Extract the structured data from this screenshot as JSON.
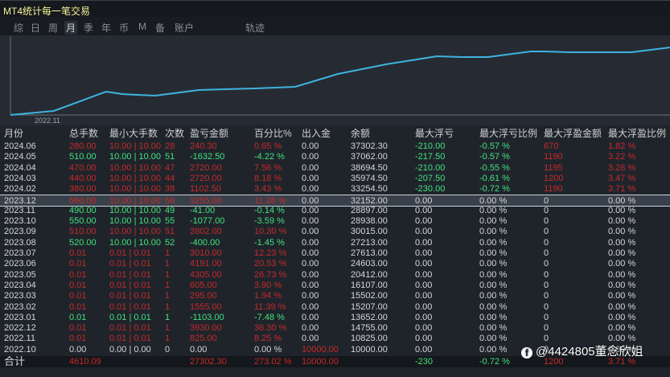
{
  "title": "MT4统计每一笔交易",
  "tabs": [
    {
      "label": "综",
      "active": false
    },
    {
      "label": "日",
      "active": false
    },
    {
      "label": "周",
      "active": false
    },
    {
      "label": "月",
      "active": true
    },
    {
      "label": "季",
      "active": false
    },
    {
      "label": "年",
      "active": false
    },
    {
      "label": "币",
      "active": false
    },
    {
      "label": "M",
      "active": false
    },
    {
      "label": "备",
      "active": false
    },
    {
      "label": "账户",
      "active": false
    },
    {
      "label": "轨迹",
      "active": false
    }
  ],
  "chart": {
    "x_label": "2022.11",
    "line_color": "#3fb3e0"
  },
  "columns": [
    "月份",
    "总手数",
    "最小大手数",
    "次数",
    "盈亏金额",
    "百分比%",
    "出入金",
    "余额",
    "最大浮亏",
    "最大浮亏比例",
    "最大浮盈金额",
    "最大浮盈比例"
  ],
  "rows": [
    {
      "c": [
        "2024.06",
        "280.00",
        "10.00 | 10.00",
        "28",
        "240.30",
        "0.65 %",
        "0.00",
        "37302.30",
        "-210.00",
        "-0.57 %",
        "670",
        "1.82 %"
      ],
      "tone": "r"
    },
    {
      "c": [
        "2024.05",
        "510.00",
        "10.00 | 10.00",
        "51",
        "-1632.50",
        "-4.22 %",
        "0.00",
        "37062.00",
        "-217.50",
        "-0.57 %",
        "1190",
        "3.22 %"
      ],
      "tone": "g"
    },
    {
      "c": [
        "2024.04",
        "470.00",
        "10.00 | 10.00",
        "47",
        "2720.00",
        "7.56 %",
        "0.00",
        "38694.50",
        "-210.00",
        "-0.55 %",
        "1195",
        "3.28 %"
      ],
      "tone": "r"
    },
    {
      "c": [
        "2024.03",
        "440.00",
        "10.00 | 10.00",
        "44",
        "2720.00",
        "8.18 %",
        "0.00",
        "35974.50",
        "-207.50",
        "-0.61 %",
        "1200",
        "3.47 %"
      ],
      "tone": "r"
    },
    {
      "c": [
        "2024.02",
        "380.00",
        "10.00 | 10.00",
        "38",
        "1102.50",
        "3.43 %",
        "0.00",
        "33254.50",
        "-230.00",
        "-0.72 %",
        "1190",
        "3.71 %"
      ],
      "tone": "r"
    },
    {
      "c": [
        "2023.12",
        "560.00",
        "10.00 | 10.00",
        "56",
        "3255.00",
        "11.26 %",
        "0.00",
        "32152.00",
        "0.00",
        "0.00 %",
        "0",
        "0.00 %"
      ],
      "tone": "r",
      "selected": true
    },
    {
      "c": [
        "2023.11",
        "490.00",
        "10.00 | 10.00",
        "49",
        "-41.00",
        "-0.14 %",
        "0.00",
        "28897.00",
        "0.00",
        "0.00 %",
        "0",
        "0.00 %"
      ],
      "tone": "g"
    },
    {
      "c": [
        "2023.10",
        "550.00",
        "10.00 | 10.00",
        "55",
        "-1077.00",
        "-3.59 %",
        "0.00",
        "28938.00",
        "0.00",
        "0.00 %",
        "0",
        "0.00 %"
      ],
      "tone": "g"
    },
    {
      "c": [
        "2023.09",
        "510.00",
        "10.00 | 10.00",
        "51",
        "2802.00",
        "10.30 %",
        "0.00",
        "30015.00",
        "0.00",
        "0.00 %",
        "0",
        "0.00 %"
      ],
      "tone": "r"
    },
    {
      "c": [
        "2023.08",
        "520.00",
        "10.00 | 10.00",
        "52",
        "-400.00",
        "-1.45 %",
        "0.00",
        "27213.00",
        "0.00",
        "0.00 %",
        "0",
        "0.00 %"
      ],
      "tone": "g"
    },
    {
      "c": [
        "2023.07",
        "0.01",
        "0.01 | 0.01",
        "1",
        "3010.00",
        "12.23 %",
        "0.00",
        "27613.00",
        "0.00",
        "0.00 %",
        "0",
        "0.00 %"
      ],
      "tone": "r"
    },
    {
      "c": [
        "2023.06",
        "0.01",
        "0.01 | 0.01",
        "1",
        "4191.00",
        "20.53 %",
        "0.00",
        "24603.00",
        "0.00",
        "0.00 %",
        "0",
        "0.00 %"
      ],
      "tone": "r"
    },
    {
      "c": [
        "2023.05",
        "0.01",
        "0.01 | 0.01",
        "1",
        "4305.00",
        "26.73 %",
        "0.00",
        "20412.00",
        "0.00",
        "0.00 %",
        "0",
        "0.00 %"
      ],
      "tone": "r"
    },
    {
      "c": [
        "2023.04",
        "0.01",
        "0.01 | 0.01",
        "1",
        "605.00",
        "3.90 %",
        "0.00",
        "16107.00",
        "0.00",
        "0.00 %",
        "0",
        "0.00 %"
      ],
      "tone": "r"
    },
    {
      "c": [
        "2023.03",
        "0.01",
        "0.01 | 0.01",
        "1",
        "295.00",
        "1.94 %",
        "0.00",
        "15502.00",
        "0.00",
        "0.00 %",
        "0",
        "0.00 %"
      ],
      "tone": "r"
    },
    {
      "c": [
        "2023.02",
        "0.01",
        "0.01 | 0.01",
        "1",
        "1555.00",
        "11.39 %",
        "0.00",
        "15207.00",
        "0.00",
        "0.00 %",
        "0",
        "0.00 %"
      ],
      "tone": "r"
    },
    {
      "c": [
        "2023.01",
        "0.01",
        "0.01 | 0.01",
        "1",
        "-1103.00",
        "-7.48 %",
        "0.00",
        "13652.00",
        "0.00",
        "0.00 %",
        "0",
        "0.00 %"
      ],
      "tone": "g"
    },
    {
      "c": [
        "2022.12",
        "0.01",
        "0.01 | 0.01",
        "1",
        "3930.00",
        "36.30 %",
        "0.00",
        "14755.00",
        "0.00",
        "0.00 %",
        "0",
        "0.00 %"
      ],
      "tone": "r"
    },
    {
      "c": [
        "2022.11",
        "0.01",
        "0.01 | 0.01",
        "1",
        "825.00",
        "8.25 %",
        "0.00",
        "10825.00",
        "0.00",
        "0.00 %",
        "0",
        "0.00 %"
      ],
      "tone": "r"
    },
    {
      "c": [
        "2022.10",
        "0.00",
        "0.00 | 0.00",
        "0",
        "0.00",
        "0.00 %",
        "10000.00",
        "10000.00",
        "0.00",
        "0.00 %",
        "0",
        "0.00 %"
      ],
      "tone": "w"
    }
  ],
  "total": {
    "label": "合计",
    "lots": "4610.09",
    "profit": "27302.30",
    "percent": "273.02 %",
    "deposit": "10000.00",
    "max_float_loss": "-230",
    "max_float_loss_pct": "-0.72 %",
    "max_float_profit": "1200",
    "max_float_profit_pct": "3.71 %"
  },
  "watermark": "@4424805董念欣姐",
  "colors": {
    "profit": "#c52a2a",
    "loss": "#41e27e",
    "neutral": "#d6d6d6"
  }
}
